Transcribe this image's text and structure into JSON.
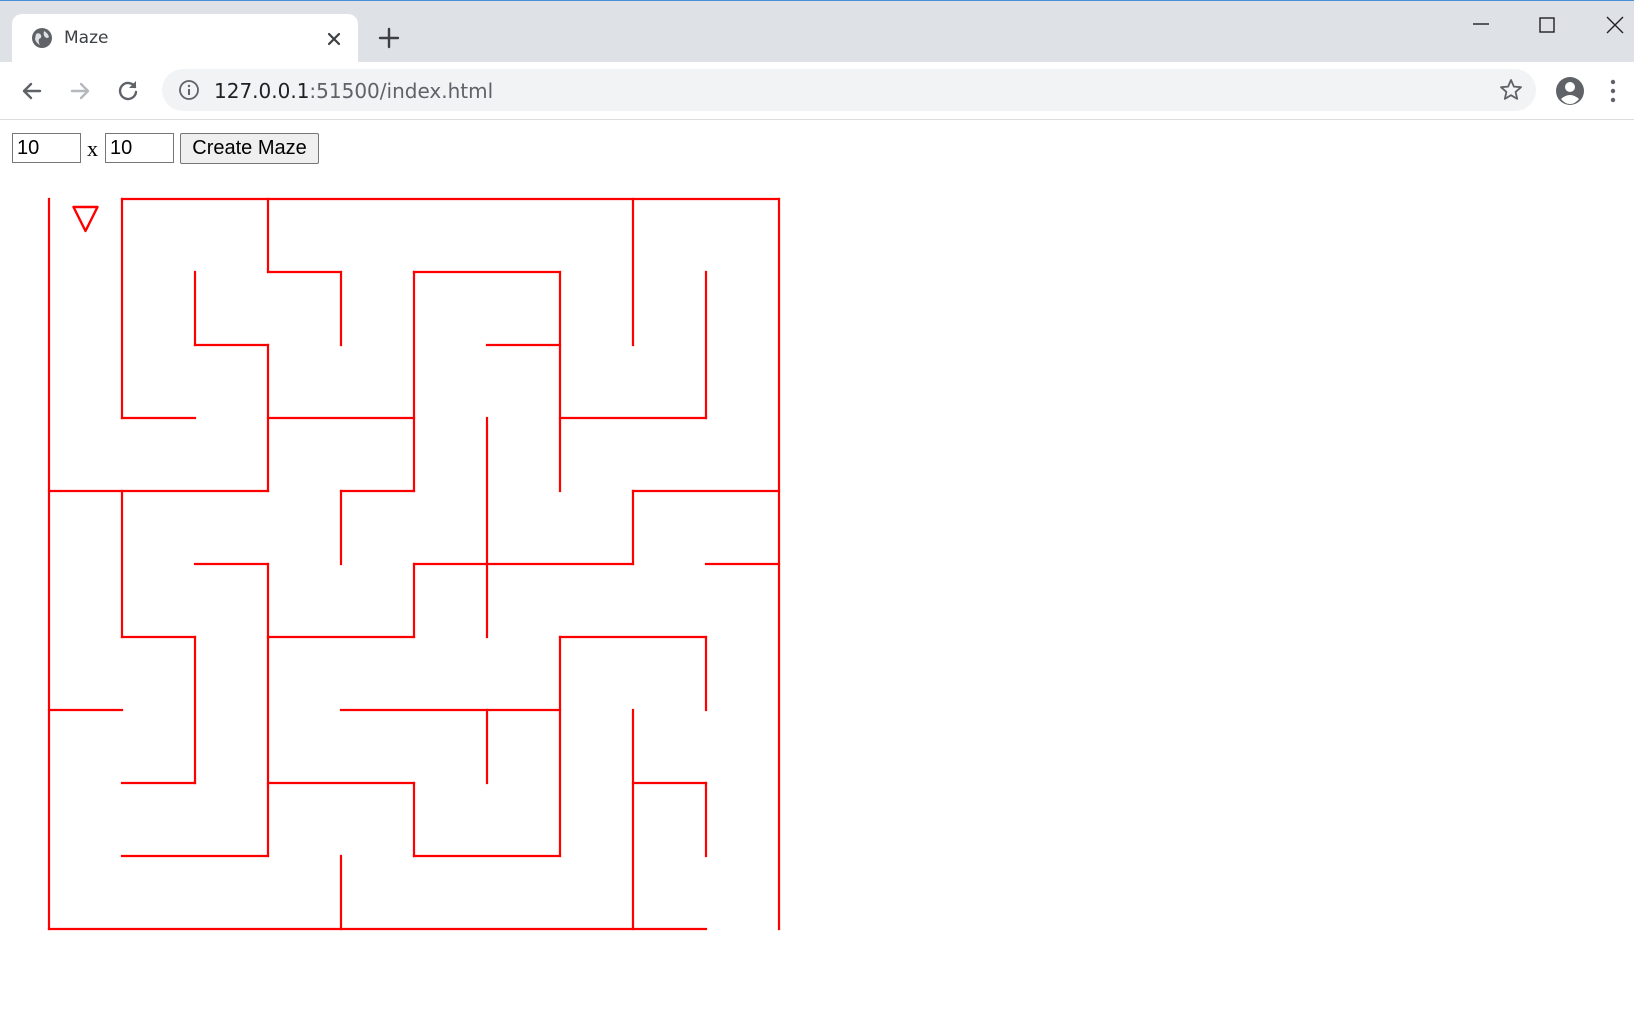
{
  "browser": {
    "tab": {
      "title": "Maze",
      "favicon": "globe-icon",
      "close_icon": "close-icon"
    },
    "new_tab_icon": "plus-icon",
    "window_controls": [
      "minimize-icon",
      "maximize-icon",
      "close-icon"
    ],
    "nav": {
      "back": "arrow-left-icon",
      "forward": "arrow-right-icon",
      "reload": "reload-icon"
    },
    "address": {
      "host": "127.0.0.1",
      "path": ":51500/index.html",
      "info_icon": "info-icon"
    },
    "bookmark_icon": "star-icon",
    "profile_icon": "account-circle-icon",
    "menu_icon": "kebab-menu-icon"
  },
  "maze_controls": {
    "width_value": "10",
    "height_value": "10",
    "separator": "x",
    "create_label": "Create Maze"
  },
  "maze": {
    "rows": 10,
    "cols": 10,
    "wall_color": "#ff0000",
    "start_marker": "triangle-down-icon",
    "start_cell": [
      0,
      0
    ]
  }
}
